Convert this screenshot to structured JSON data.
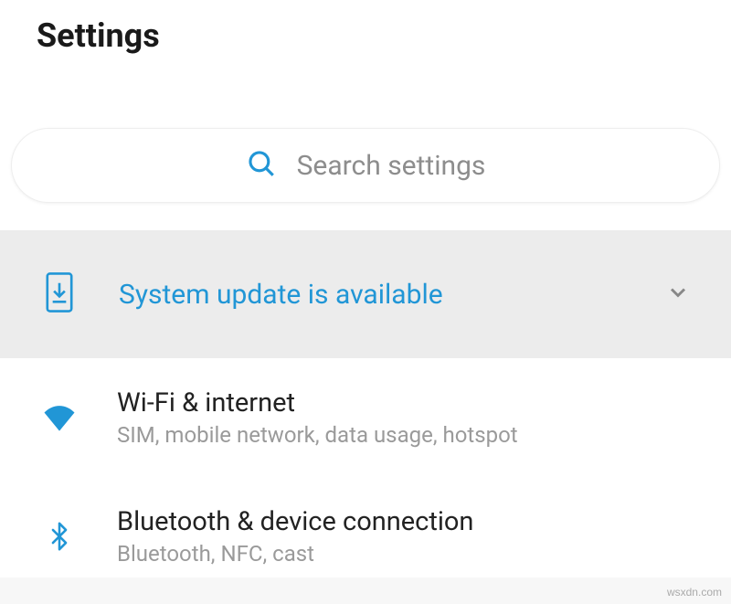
{
  "header": {
    "title": "Settings"
  },
  "search": {
    "placeholder": "Search settings"
  },
  "update_banner": {
    "title": "System update is available"
  },
  "colors": {
    "accent": "#2196d6",
    "muted": "#9a9a9a"
  },
  "items": [
    {
      "icon": "wifi-icon",
      "title": "Wi-Fi & internet",
      "subtitle": "SIM, mobile network, data usage, hotspot"
    },
    {
      "icon": "bluetooth-icon",
      "title": "Bluetooth & device connection",
      "subtitle": "Bluetooth, NFC, cast"
    }
  ],
  "watermark": "wsxdn.com"
}
